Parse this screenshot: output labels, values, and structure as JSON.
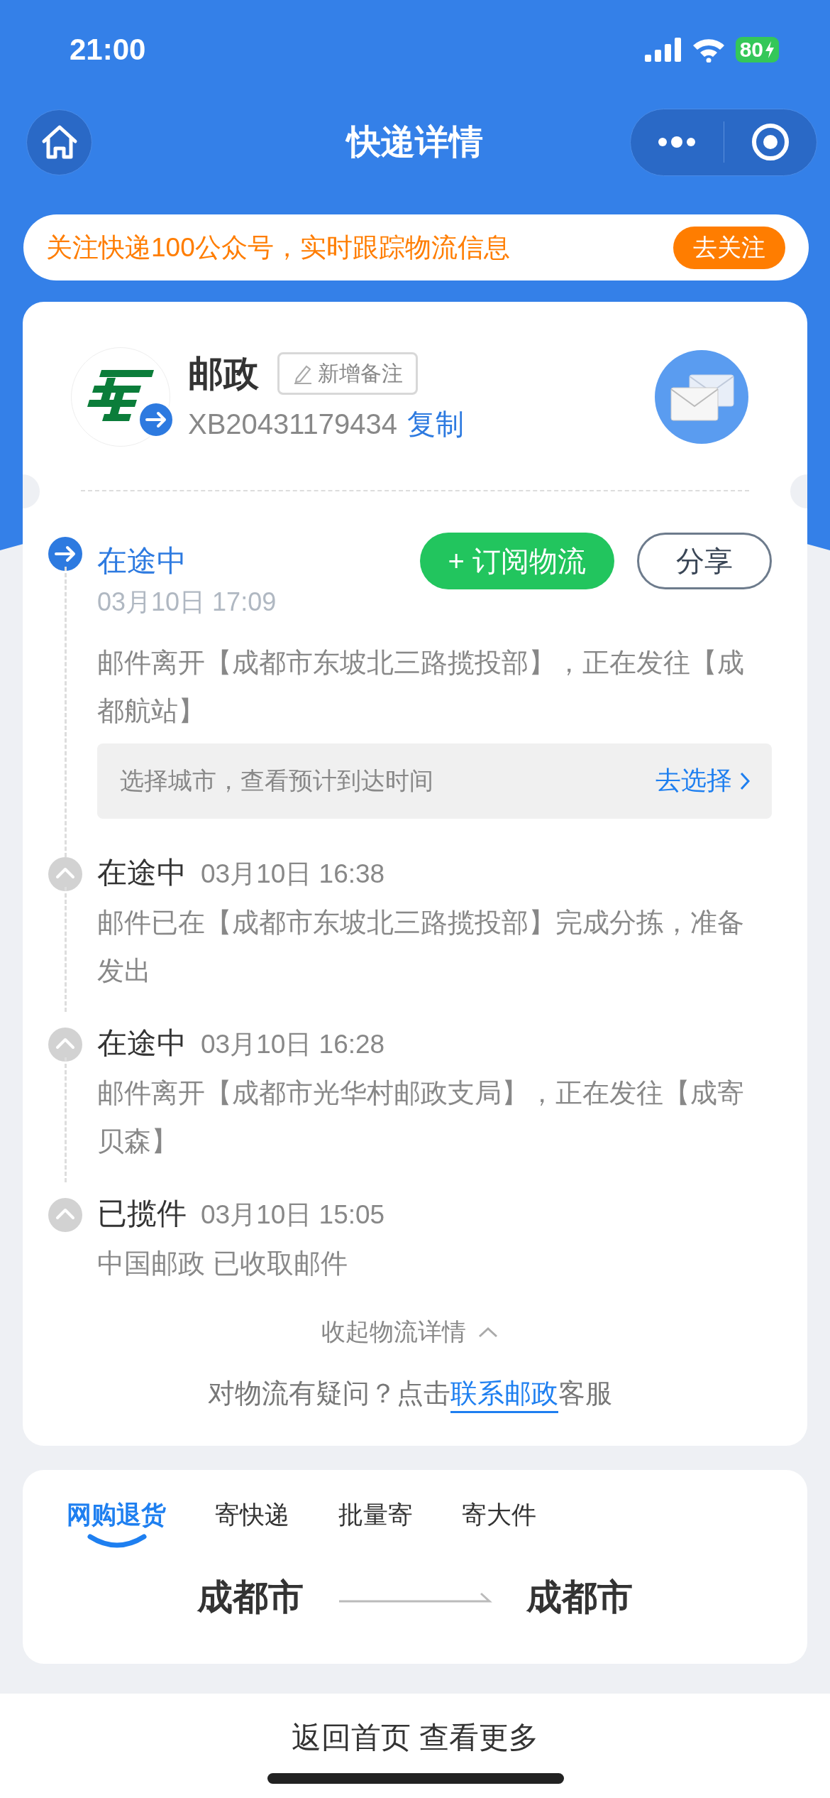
{
  "status_bar": {
    "time": "21:00",
    "battery": "80"
  },
  "nav": {
    "title": "快递详情"
  },
  "banner": {
    "text": "关注快递100公众号，实时跟踪物流信息",
    "button": "去关注"
  },
  "carrier": {
    "name": "邮政",
    "note_button": "新增备注",
    "tracking_number": "XB20431179434",
    "copy": "复制"
  },
  "latest": {
    "status": "在途中",
    "time": "03月10日 17:09",
    "subscribe": "+ 订阅物流",
    "share": "分享",
    "description": "邮件离开【成都市东坡北三路揽投部】，正在发往【成都航站】",
    "hint": "选择城市，查看预计到达时间",
    "hint_action": "去选择"
  },
  "events": [
    {
      "status": "在途中",
      "time": "03月10日 16:38",
      "description": "邮件已在【成都市东坡北三路揽投部】完成分拣，准备发出"
    },
    {
      "status": "在途中",
      "time": "03月10日 16:28",
      "description": "邮件离开【成都市光华村邮政支局】，正在发往【成寄贝森】"
    },
    {
      "status": "已揽件",
      "time": "03月10日 15:05",
      "description": "中国邮政 已收取邮件"
    }
  ],
  "collapse": "收起物流详情",
  "contact": {
    "text": "对物流有疑问？点击",
    "link": "联系邮政",
    "suffix": "客服"
  },
  "send_tabs": [
    {
      "label": "网购退货",
      "selected": true
    },
    {
      "label": "寄快递",
      "selected": false
    },
    {
      "label": "批量寄",
      "selected": false
    },
    {
      "label": "寄大件",
      "selected": false
    }
  ],
  "route": {
    "from": "成都市",
    "to": "成都市"
  },
  "footer": "返回首页 查看更多"
}
